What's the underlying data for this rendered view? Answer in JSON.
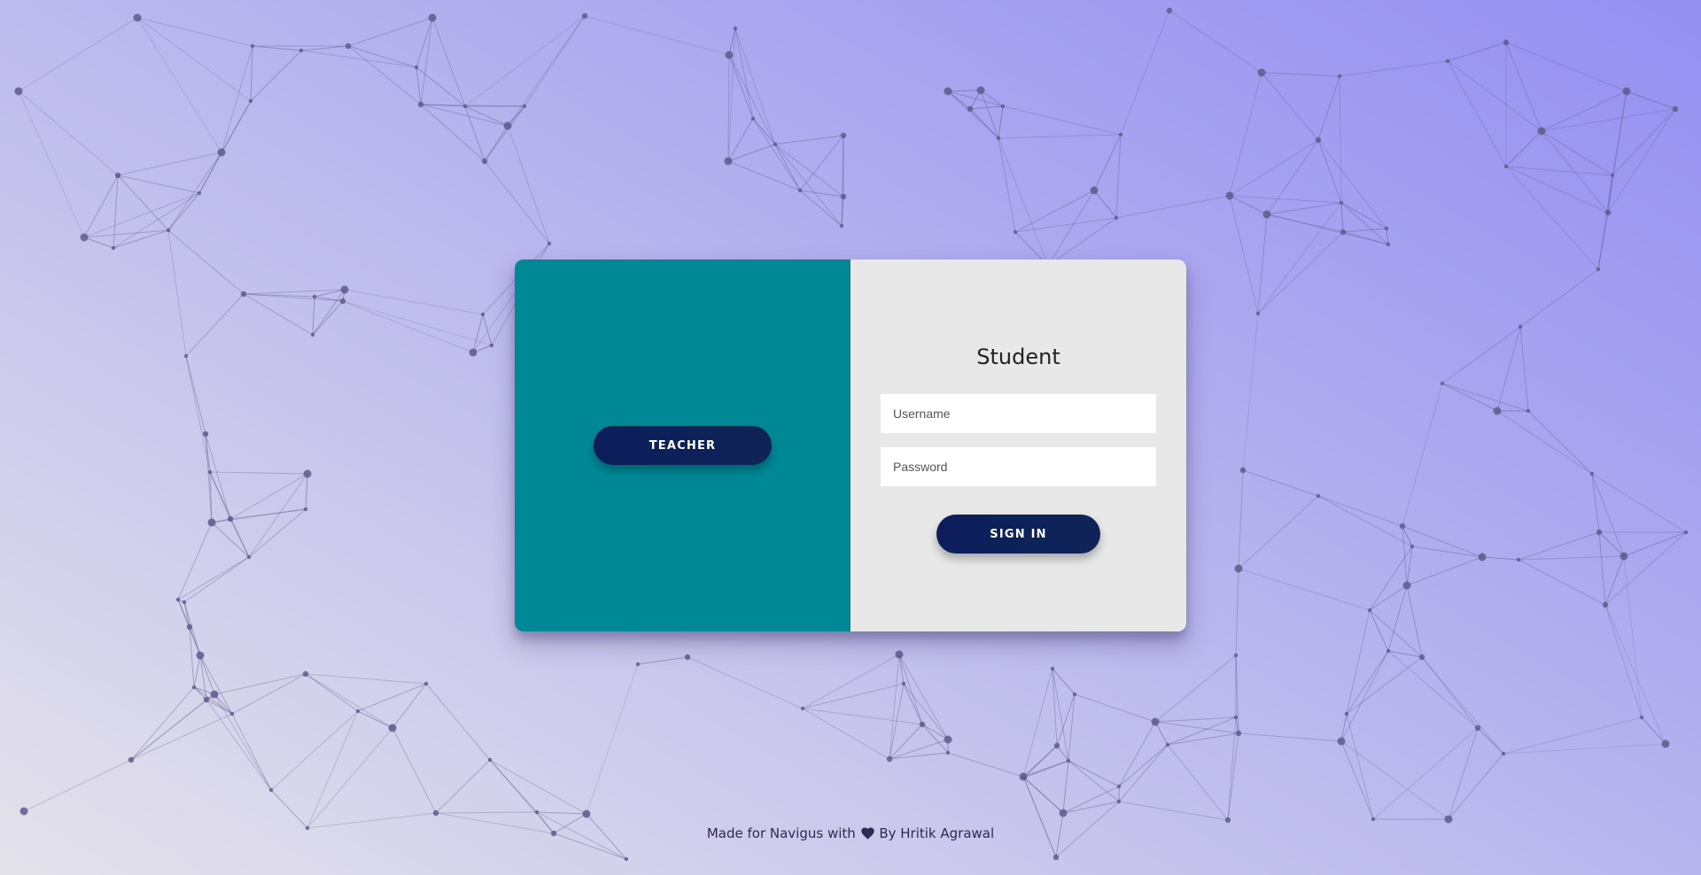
{
  "colors": {
    "overlay_panel": "#008896",
    "form_panel": "#e8e8e8",
    "button": "#0d1d5c",
    "network_stroke": "#5d5887",
    "network_dot": "#5f5a8c"
  },
  "overlay": {
    "switch_button_label": "TEACHER"
  },
  "form": {
    "title": "Student",
    "username_placeholder": "Username",
    "password_placeholder": "Password",
    "submit_label": "SIGN IN"
  },
  "footer": {
    "prefix": "Made for Navigus with",
    "heart_icon": "heart-icon",
    "suffix": "By Hritik Agrawal"
  },
  "background": {
    "decoration": "particle-network"
  }
}
